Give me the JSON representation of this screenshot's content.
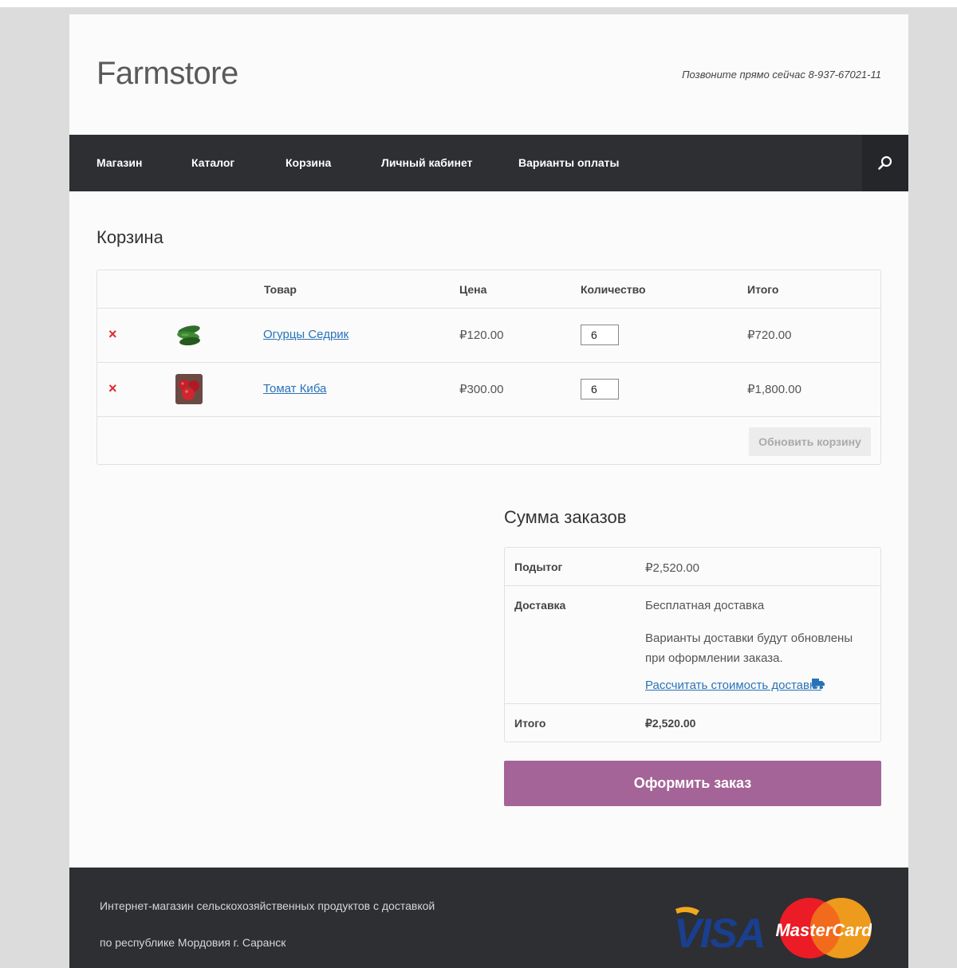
{
  "header": {
    "site_title": "Farmstore",
    "phone_text": "Позвоните прямо сейчас 8-937-67021-11"
  },
  "nav": {
    "items": [
      "Магазин",
      "Каталог",
      "Корзина",
      "Личный кабинет",
      "Варианты оплаты"
    ],
    "search_icon": "search-icon"
  },
  "cart": {
    "heading": "Корзина",
    "columns": [
      "Товар",
      "Цена",
      "Количество",
      "Итого"
    ],
    "remove_symbol": "×",
    "rows": [
      {
        "name": "Огурцы Седрик",
        "price": "₽120.00",
        "qty": "6",
        "subtotal": "₽720.00",
        "thumb": "cucumber-image"
      },
      {
        "name": "Томат Киба",
        "price": "₽300.00",
        "qty": "6",
        "subtotal": "₽1,800.00",
        "thumb": "tomato-image"
      }
    ],
    "update_button": "Обновить корзину"
  },
  "totals": {
    "heading": "Сумма заказов",
    "subtotal_label": "Подытог",
    "subtotal_value": "₽2,520.00",
    "shipping_label": "Доставка",
    "shipping_value": "Бесплатная доставка",
    "shipping_note": "Варианты доставки будут обновлены при оформлении заказа.",
    "calc_link": "Рассчитать стоимость доставки",
    "total_label": "Итого",
    "total_value": "₽2,520.00"
  },
  "checkout_button": "Оформить заказ",
  "footer": {
    "line1": "Интернет-магазин сельскохозяйственных продуктов с доставкой",
    "line2": "по республике Мордовия г. Саранск",
    "visa_text": "VISA",
    "mastercard_text": "MasterCard"
  },
  "colors": {
    "accent": "#a46497",
    "link": "#2a72b8",
    "nav_bg": "#2d2f33",
    "remove": "#e2282a"
  }
}
